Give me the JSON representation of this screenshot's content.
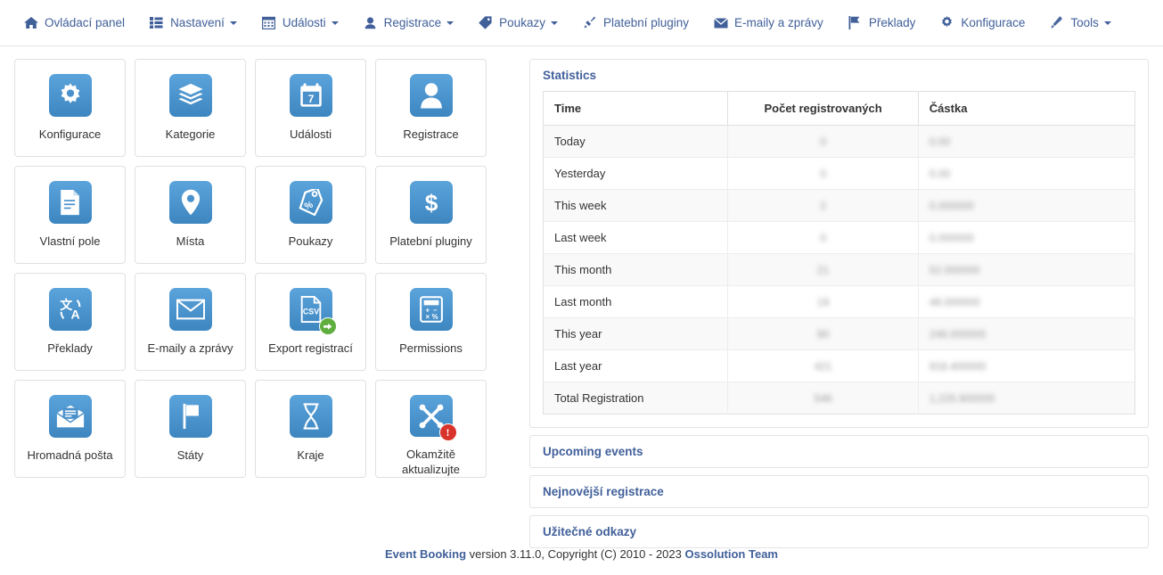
{
  "nav": {
    "items": [
      {
        "label": "Ovládací panel",
        "icon": "home-icon",
        "caret": false
      },
      {
        "label": "Nastavení",
        "icon": "list-icon",
        "caret": true
      },
      {
        "label": "Události",
        "icon": "calendar-icon",
        "caret": true
      },
      {
        "label": "Registrace",
        "icon": "user-icon",
        "caret": true
      },
      {
        "label": "Poukazy",
        "icon": "tag-icon",
        "caret": true
      },
      {
        "label": "Platební pluginy",
        "icon": "plug-icon",
        "caret": false
      },
      {
        "label": "E-maily a zprávy",
        "icon": "envelope-icon",
        "caret": false
      },
      {
        "label": "Překlady",
        "icon": "flag-icon",
        "caret": false
      },
      {
        "label": "Konfigurace",
        "icon": "gear-icon",
        "caret": false
      },
      {
        "label": "Tools",
        "icon": "pencil-icon",
        "caret": true
      }
    ]
  },
  "tiles": [
    {
      "label": "Konfigurace",
      "icon": "gear-icon",
      "badge": null
    },
    {
      "label": "Kategorie",
      "icon": "layers-icon",
      "badge": null
    },
    {
      "label": "Události",
      "icon": "calendar-7-icon",
      "badge": null
    },
    {
      "label": "Registrace",
      "icon": "user-icon",
      "badge": null
    },
    {
      "label": "Vlastní pole",
      "icon": "document-icon",
      "badge": null
    },
    {
      "label": "Místa",
      "icon": "map-pin-icon",
      "badge": null
    },
    {
      "label": "Poukazy",
      "icon": "discount-tag-icon",
      "badge": null
    },
    {
      "label": "Platební pluginy",
      "icon": "dollar-icon",
      "badge": null
    },
    {
      "label": "Překlady",
      "icon": "translate-icon",
      "badge": null
    },
    {
      "label": "E-maily a zprávy",
      "icon": "envelope-icon",
      "badge": null
    },
    {
      "label": "Export registrací",
      "icon": "csv-file-icon",
      "badge": "green-arrow"
    },
    {
      "label": "Permissions",
      "icon": "calculator-icon",
      "badge": null
    },
    {
      "label": "Hromadná pošta",
      "icon": "open-envelope-icon",
      "badge": null
    },
    {
      "label": "Státy",
      "icon": "flag-icon",
      "badge": null
    },
    {
      "label": "Kraje",
      "icon": "hourglass-icon",
      "badge": null
    },
    {
      "label": "Okamžitě aktualizujte",
      "icon": "joomla-icon",
      "badge": "red-alert"
    }
  ],
  "statistics": {
    "title": "Statistics",
    "columns": [
      "Time",
      "Počet registrovaných",
      "Částka"
    ],
    "rows": [
      {
        "time": "Today",
        "count": "0",
        "amount": "0.00"
      },
      {
        "time": "Yesterday",
        "count": "0",
        "amount": "0.00"
      },
      {
        "time": "This week",
        "count": "2",
        "amount": "0.000000"
      },
      {
        "time": "Last week",
        "count": "0",
        "amount": "0.000000"
      },
      {
        "time": "This month",
        "count": "21",
        "amount": "52.000000"
      },
      {
        "time": "Last month",
        "count": "19",
        "amount": "48.000000"
      },
      {
        "time": "This year",
        "count": "90",
        "amount": "246.000000"
      },
      {
        "time": "Last year",
        "count": "421",
        "amount": "918.400000"
      },
      {
        "time": "Total Registration",
        "count": "546",
        "amount": "1,225.900000"
      }
    ]
  },
  "panels": [
    {
      "title": "Upcoming events"
    },
    {
      "title": "Nejnovější registrace"
    },
    {
      "title": "Užitečné odkazy"
    }
  ],
  "footer": {
    "product": "Event Booking",
    "middle": " version 3.11.0, Copyright (C) 2010 - 2023 ",
    "vendor": "Ossolution Team"
  }
}
